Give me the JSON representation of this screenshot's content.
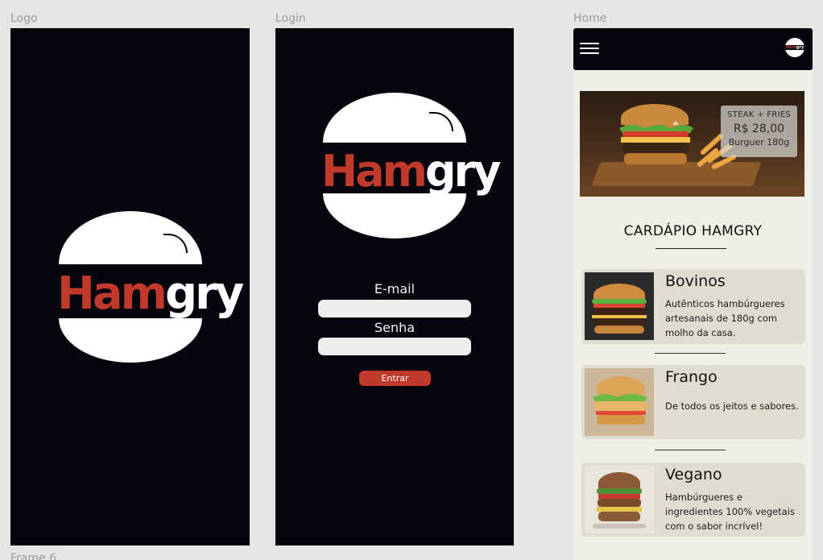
{
  "frames": {
    "logo": "Logo",
    "login": "Login",
    "home": "Home",
    "frame6": "Frame 6"
  },
  "brand": {
    "ham": "Ham",
    "gry": "gry",
    "mini": "Hamgry",
    "accent": "#c0392b",
    "dark": "#05050f"
  },
  "login": {
    "email_label": "E-mail",
    "password_label": "Senha",
    "email_value": "",
    "password_value": "",
    "submit": "Entrar"
  },
  "home": {
    "menu_icon": "hamburger-menu-icon",
    "banner": {
      "line1": "STEAK  + FRIES",
      "price": "R$ 28,00",
      "line3": "Burguer 180g"
    },
    "section_title": "CARDÁPIO HAMGRY",
    "cards": [
      {
        "name": "Bovinos",
        "description": "Autênticos hambúrgueres artesanais de 180g com molho da casa."
      },
      {
        "name": "Frango",
        "description": "De todos os jeitos e sabores."
      },
      {
        "name": "Vegano",
        "description": "Hambúrgueres e ingredientes 100% vegetais com o sabor incrível!"
      }
    ]
  }
}
